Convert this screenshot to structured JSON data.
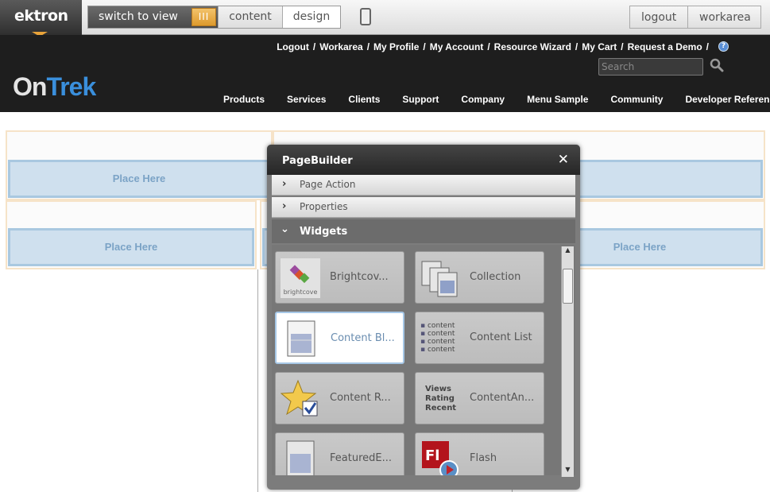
{
  "toolbar": {
    "logo": "ektron",
    "switch_label": "switch to view",
    "switch_knob": "III",
    "content_label": "content",
    "design_label": "design",
    "logout_label": "logout",
    "workarea_label": "workarea"
  },
  "header": {
    "links": [
      "Logout",
      "Workarea",
      "My Profile",
      "My Account",
      "Resource Wizard",
      "My Cart",
      "Request a Demo"
    ],
    "separator": "/",
    "search_placeholder": "Search",
    "brand_on": "On",
    "brand_trek": "Trek",
    "nav": [
      "Products",
      "Services",
      "Clients",
      "Support",
      "Company",
      "Menu Sample",
      "Community",
      "Developer Reference"
    ]
  },
  "zones": {
    "drop_label": "Place Here"
  },
  "pagebuilder": {
    "title": "PageBuilder",
    "close": "✕",
    "sections": [
      "Page Action",
      "Properties"
    ],
    "widgets_heading": "Widgets",
    "widgets": [
      {
        "label": "Brightcov...",
        "icon": "brightcove-icon"
      },
      {
        "label": "Collection",
        "icon": "collection-icon"
      },
      {
        "label": "Content Bl...",
        "icon": "content-block-icon",
        "selected": true
      },
      {
        "label": "Content List",
        "icon": "content-list-icon"
      },
      {
        "label": "Content R...",
        "icon": "content-rating-icon"
      },
      {
        "label": "ContentAn...",
        "icon": "content-analytics-icon"
      },
      {
        "label": "FeaturedE...",
        "icon": "featured-icon"
      },
      {
        "label": "Flash",
        "icon": "flash-icon"
      }
    ],
    "thumb_text": {
      "brightcove": "brightcove",
      "content_list": [
        "content",
        "content",
        "content",
        "content"
      ],
      "analytics": [
        "Views",
        "Rating",
        "Recent"
      ],
      "flash": "Fl"
    }
  },
  "colors": {
    "accent_blue": "#3a8fdc",
    "toggle_orange": "#dd9a2c",
    "drop_zone": "#cfe0ee"
  }
}
